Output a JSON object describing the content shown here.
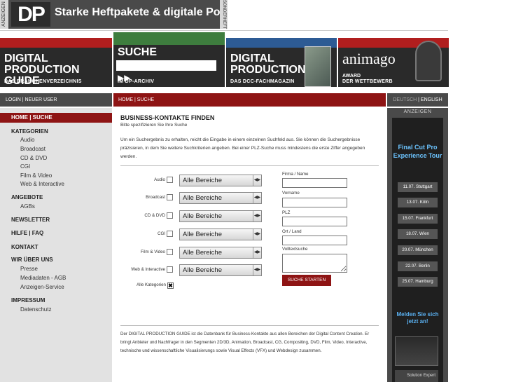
{
  "top_banner": {
    "side_label_left": "ANZEIGEN",
    "logo": "DP",
    "slogan": "Starke Heftpakete & digitale Power",
    "side_label_right": "SONDERHEFT"
  },
  "tiles": {
    "guide": {
      "line1": "DIGITAL",
      "line2": "PRODUCTION GUIDE",
      "sub": "DAS BRANCHENVERZEICHNIS"
    },
    "search": {
      "title": "SUCHE",
      "sub": "IM DP-ARCHIV",
      "arrow": "▶▶"
    },
    "magazine": {
      "line1": "DIGITAL",
      "line2": "PRODUCTION",
      "sub": "DAS DCC-FACHMAGAZIN"
    },
    "animago": {
      "title": "animago",
      "award": "AWARD",
      "sub": "DER WETTBEWERB"
    }
  },
  "bars": {
    "login": "LOGIN | NEUER USER",
    "breadcrumb": "HOME | SUCHE",
    "lang_de": "DEUTSCH",
    "lang_sep": " | ",
    "lang_en": "ENGLISH"
  },
  "sidebar": {
    "home": "HOME | SUCHE",
    "kategorien": "KATEGORIEN",
    "kategorien_items": [
      "Audio",
      "Broadcast",
      "CD & DVD",
      "CGI",
      "Film & Video",
      "Web & Interactive"
    ],
    "angebote": "ANGEBOTE",
    "angebote_items": [
      "AGBs"
    ],
    "newsletter": "NEWSLETTER",
    "hilfe": "HILFE | FAQ",
    "kontakt": "KONTAKT",
    "wir": "WIR ÜBER UNS",
    "wir_items": [
      "Presse",
      "Mediadaten - AGB",
      "Anzeigen-Service"
    ],
    "impressum": "IMPRESSUM",
    "impressum_items": [
      "Datenschutz"
    ]
  },
  "main": {
    "title": "BUSINESS-KONTAKTE FINDEN",
    "subtitle": "Bitte spezifizieren Sie Ihre Suche",
    "description": "Um ein Suchergebnis zu erhalten, reicht die Eingabe in einem einzelnen Suchfeld aus. Sie können die Suchergebnisse präzisieren, in dem Sie weitere Suchkriterien angeben. Bei einer PLZ-Suche muss mindestens die erste Ziffer angegeben werden.",
    "categories": [
      {
        "label": "Audio",
        "value": "Alle Bereiche"
      },
      {
        "label": "Broadcast",
        "value": "Alle Bereiche"
      },
      {
        "label": "CD & DVD",
        "value": "Alle Bereiche"
      },
      {
        "label": "CGI",
        "value": "Alle Bereiche"
      },
      {
        "label": "Film & Video",
        "value": "Alle Bereiche"
      },
      {
        "label": "Web & Interactive",
        "value": "Alle Bereiche"
      }
    ],
    "all_categories": "Alle Kategorien",
    "all_categories_mark": "✖",
    "fields": [
      "Firma / Name",
      "Vorname",
      "PLZ",
      "Ort / Land"
    ],
    "fulltext": "Volltextsuche",
    "submit": "SUCHE STARTEN",
    "footer": "Der DIGITAL PRODUCTION GUIDE ist die Datenbank für Business-Kontakte aus allen Bereichen der Digital Content Creation. Er bringt Anbieter und Nachfrager in den Segmenten 2D/3D, Animation, Broadcast, CG, Compositing, DVD, Film, Video, Interactive, technische und wissenschaftliche Visualisierungs sowie Visual Effects (VFX) und Webdesign zusammen."
  },
  "right_ad": {
    "label": "ANZEIGEN",
    "line1": "Final Cut Pro",
    "line2": "Experience Tour",
    "cities": [
      "11.07. Stuttgart",
      "13.07. Köln",
      "15.07. Frankfurt",
      "18.07. Wien",
      "20.07. München",
      "22.07. Berlin",
      "25.07. Hamburg"
    ],
    "cta1": "Melden Sie sich",
    "cta2": "jetzt an!",
    "footer": "Solution Expert"
  }
}
